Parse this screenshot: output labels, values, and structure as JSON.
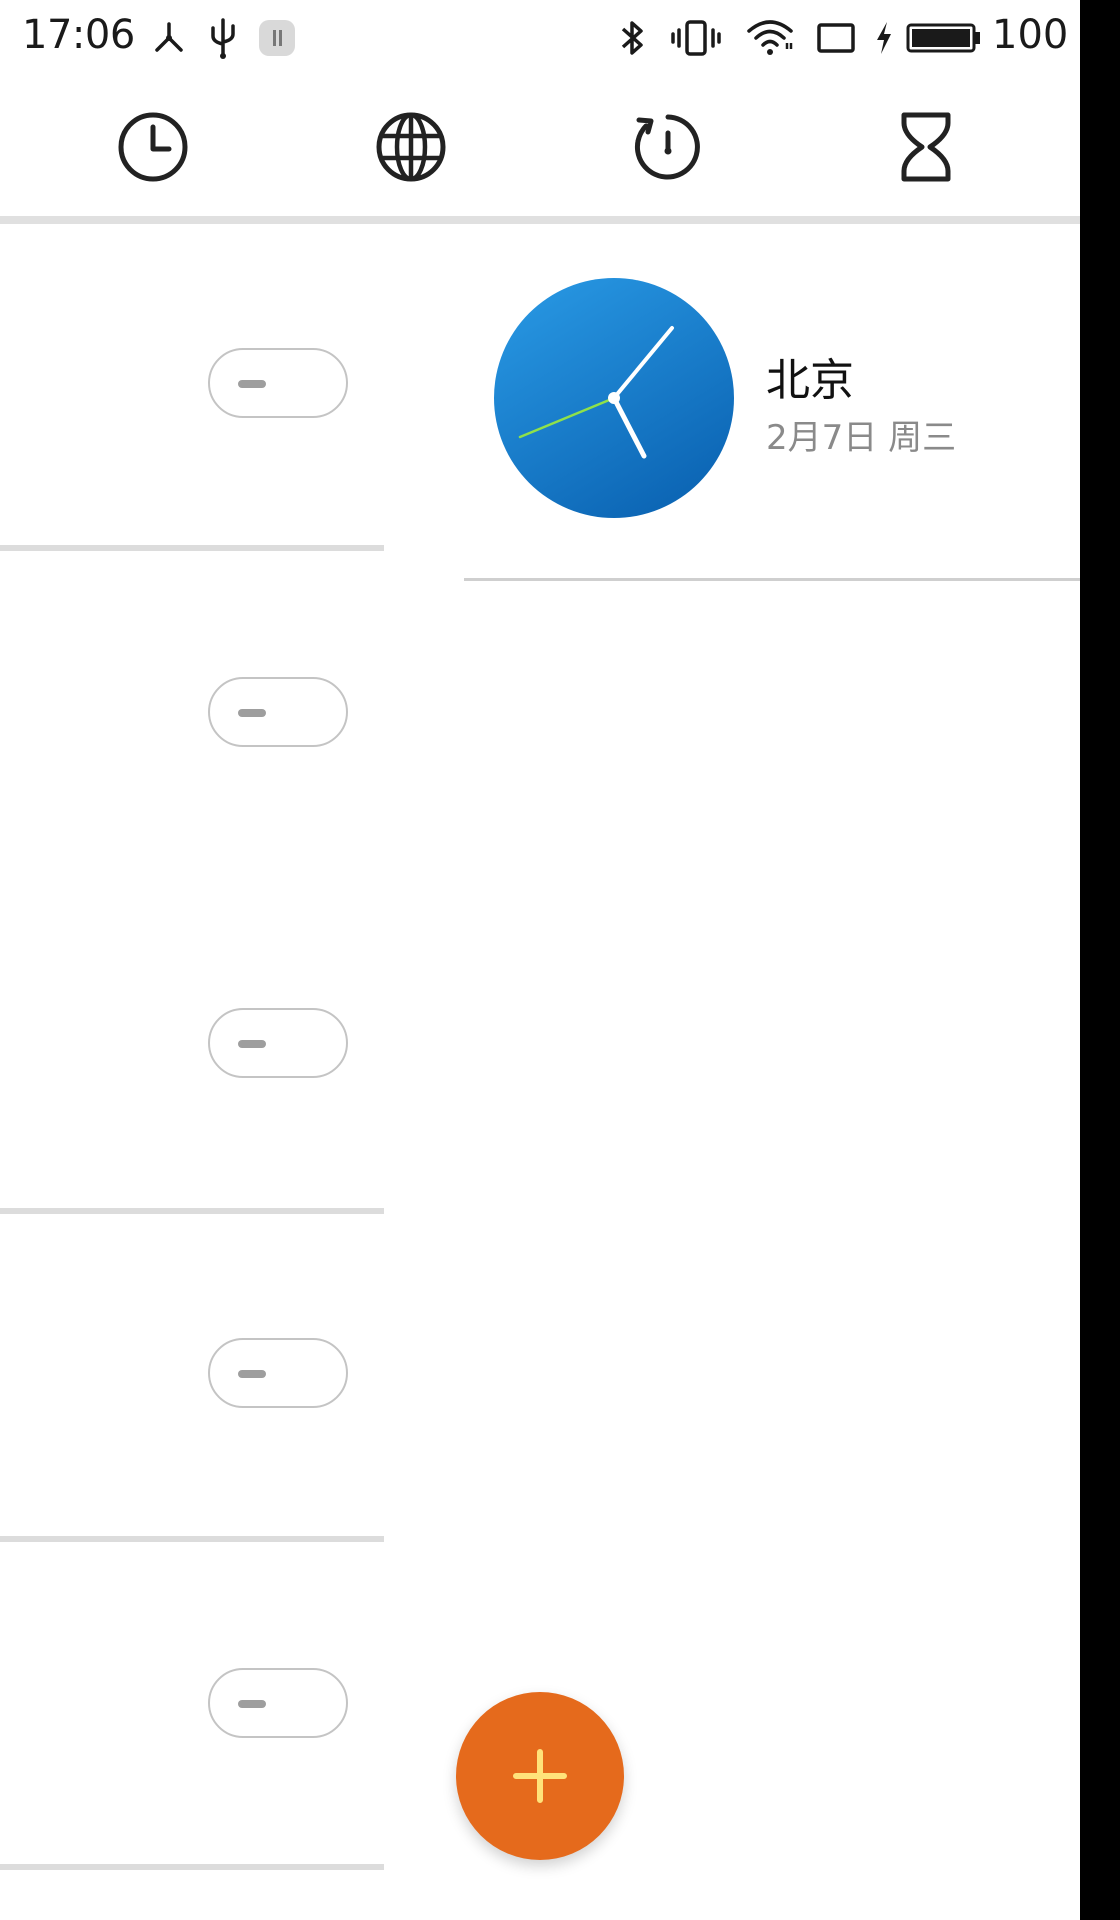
{
  "status_bar": {
    "time": "17:06",
    "battery_level": "100",
    "left_icons": [
      "network-share-icon",
      "usb-icon",
      "pause-notification-icon"
    ],
    "right_icons": [
      "bluetooth-icon",
      "vibrate-icon",
      "wifi-icon",
      "screen-icon",
      "charging-icon",
      "battery-icon"
    ]
  },
  "tabs": [
    {
      "icon": "alarm-clock-icon",
      "selected": false
    },
    {
      "icon": "world-clock-globe-icon",
      "selected": true
    },
    {
      "icon": "stopwatch-icon",
      "selected": false
    },
    {
      "icon": "timer-hourglass-icon",
      "selected": false
    }
  ],
  "alarms": [
    {
      "enabled": false
    },
    {
      "enabled": false
    },
    {
      "enabled": false
    },
    {
      "enabled": false
    },
    {
      "enabled": false
    }
  ],
  "world_clocks": [
    {
      "city": "北京",
      "date": "2月7日 周三"
    }
  ],
  "colors": {
    "clock_face_top": "#2a9be6",
    "clock_face_bottom": "#0d67b6",
    "second_hand": "#8fe14a",
    "fab": "#e56a1c",
    "fab_plus": "#ffe27a",
    "divider": "#e0e0e0"
  },
  "fab": {
    "icon": "add-icon"
  }
}
